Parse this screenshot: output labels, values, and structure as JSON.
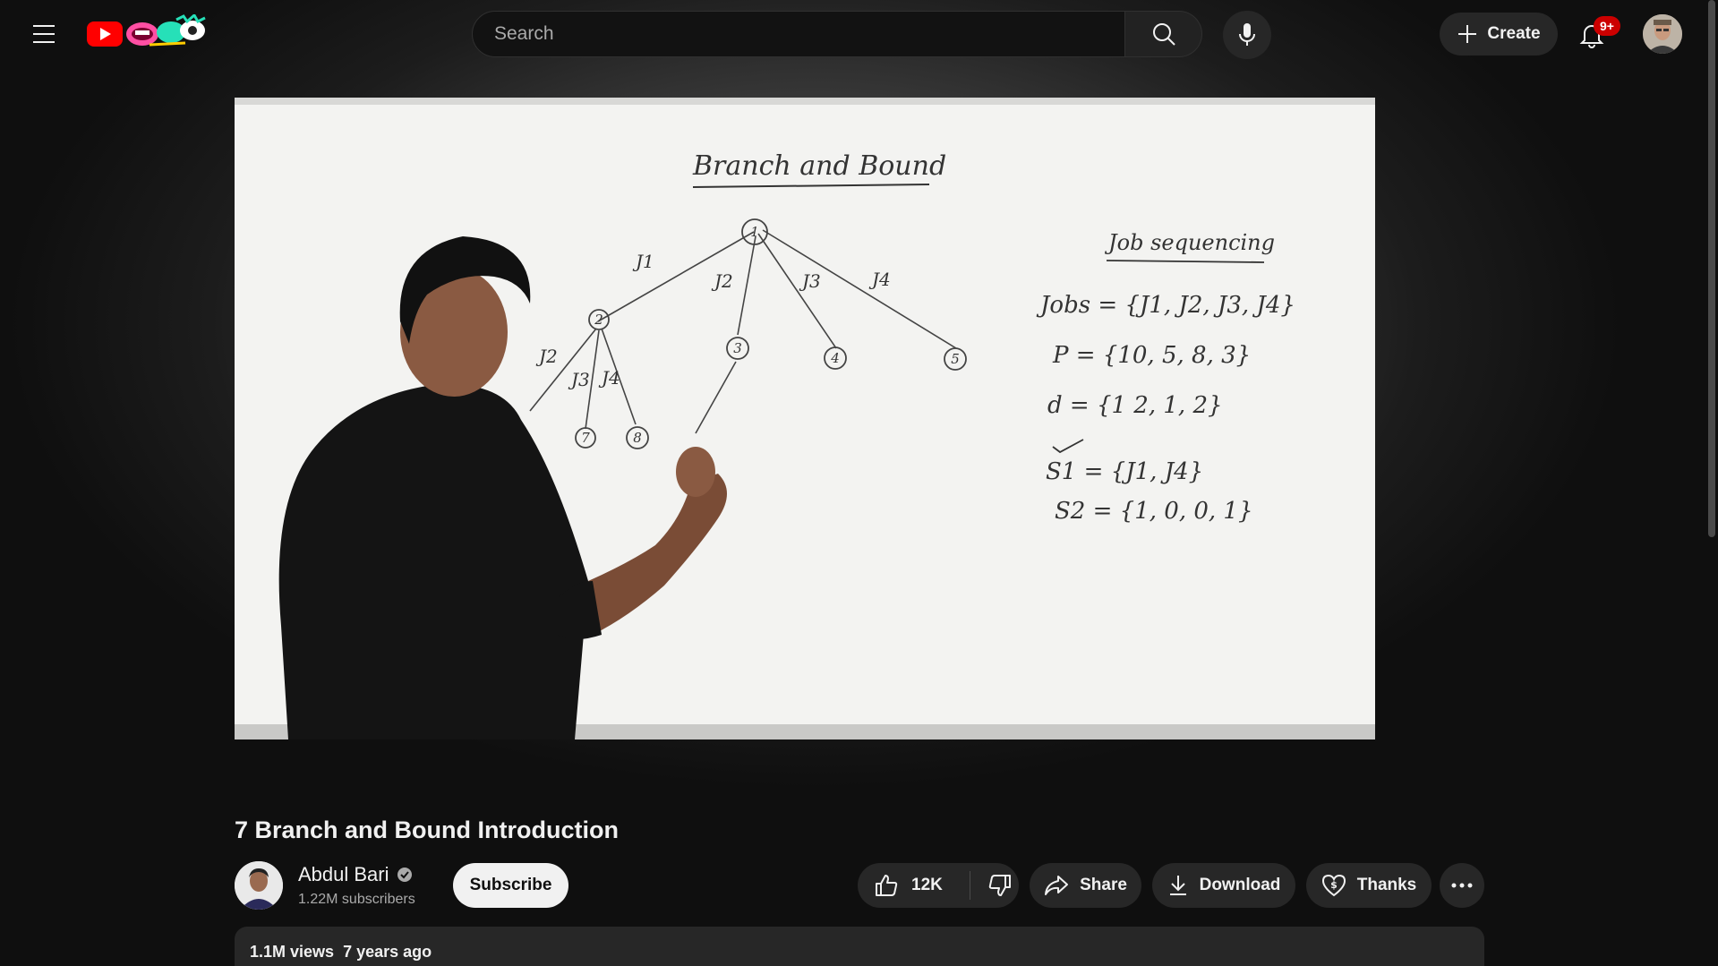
{
  "header": {
    "search_placeholder": "Search",
    "create_label": "Create",
    "notification_count": "9+",
    "icons": {
      "menu": "menu-icon",
      "search": "search-icon",
      "mic": "mic-icon",
      "create": "plus-icon",
      "bell": "bell-icon"
    }
  },
  "video": {
    "title": "7 Branch and Bound Introduction",
    "whiteboard": {
      "heading": "Branch and Bound",
      "side_title": "Job sequencing",
      "lines": [
        "Jobs = {J1, J2, J3, J4}",
        "P = {10, 5, 8, 3}",
        "d = {1 2, 1, 2}",
        "S1 = {J1, J4}",
        "S2 = {1, 0, 0, 1}"
      ],
      "edge_labels": [
        "J1",
        "J2",
        "J3",
        "J4",
        "J2",
        "J3",
        "J4"
      ],
      "nodes": [
        "1",
        "2",
        "3",
        "4",
        "5",
        "7",
        "8"
      ]
    }
  },
  "channel": {
    "name": "Abdul Bari",
    "subscribers": "1.22M subscribers",
    "subscribe_label": "Subscribe"
  },
  "actions": {
    "like_count": "12K",
    "share_label": "Share",
    "download_label": "Download",
    "thanks_label": "Thanks"
  },
  "description": {
    "views": "1.1M views",
    "age": "7 years ago"
  },
  "colors": {
    "background": "#0f0f0f",
    "surface": "#272727",
    "brand_red": "#ff0000",
    "badge_red": "#cc0000",
    "text": "#f1f1f1",
    "secondary_text": "#aaaaaa"
  }
}
